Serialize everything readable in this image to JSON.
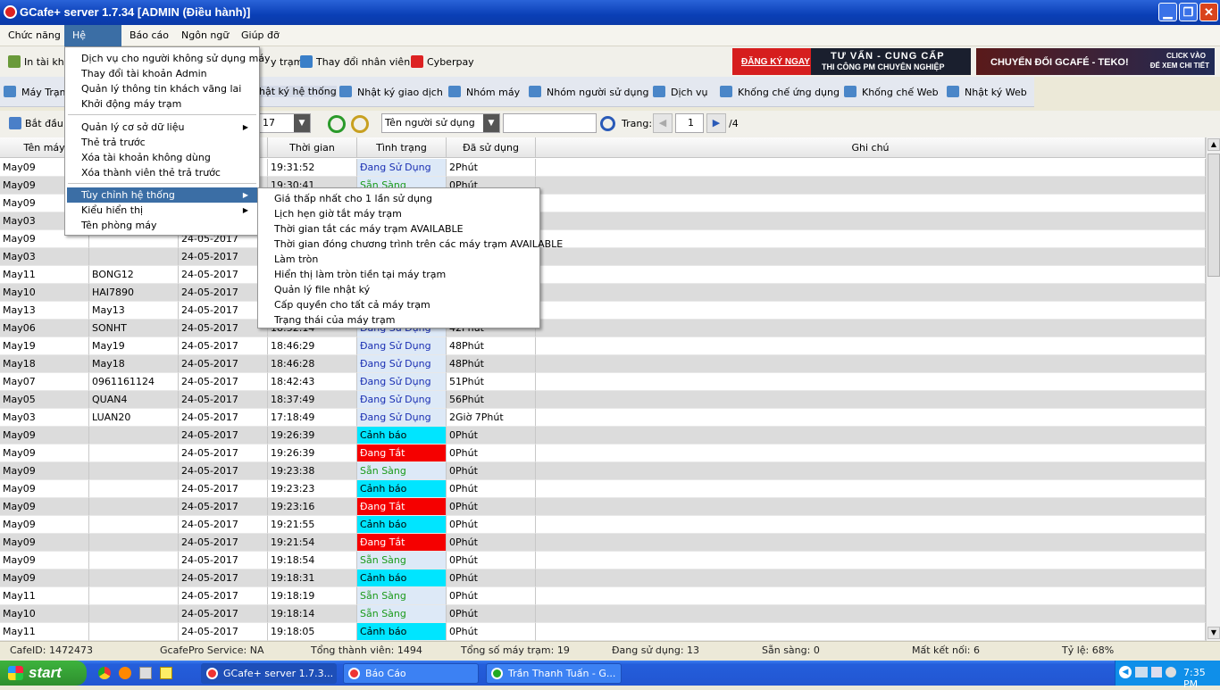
{
  "window": {
    "title": "GCafe+ server 1.7.34 [ADMIN (Điều hành)]"
  },
  "menubar": [
    "Chức năng",
    "Hệ thống",
    "Báo cáo",
    "Ngôn ngữ",
    "Giúp đỡ"
  ],
  "toolbar1": {
    "print": "In tài kho",
    "station": "y trạm",
    "change_staff": "Thay đổi nhân viên",
    "cyberpay": "Cyberpay",
    "banner1": {
      "cta": "ĐĂNG KÝ NGAY",
      "line1": "TƯ VẤN - CUNG CẤP",
      "line2": "THI CÔNG PM CHUYÊN NGHIỆP"
    },
    "banner2": {
      "main": "CHUYỂN ĐỔI  GCAFÉ - TEKO!",
      "cta1": "CLICK VÀO",
      "cta2": "ĐỂ XEM CHI TIẾT"
    }
  },
  "toolbar2": [
    "Máy Trạm",
    "hật ký hệ thống",
    "Nhật ký giao dịch",
    "Nhóm máy",
    "Nhóm người sử dụng",
    "Dịch vụ",
    "Khống chế ứng dụng",
    "Khống chế Web",
    "Nhật ký Web"
  ],
  "toolbar3": {
    "start": "Bắt đầu",
    "date_suffix": "17",
    "user_filter": "Tên người sử dụng",
    "search_value": "",
    "page_label": "Trang:",
    "page": "1",
    "page_total": "/4"
  },
  "table": {
    "headers": [
      "Tên máy",
      "",
      "",
      "Thời gian",
      "Tình trạng",
      "Đã sử dụng",
      "Ghi chú"
    ],
    "rows": [
      [
        "May09",
        "",
        "",
        "19:31:52",
        "Đang Sử Dụng",
        "2Phút"
      ],
      [
        "May09",
        "",
        "",
        "19:30:41",
        "Sẵn Sàng",
        "0Phút"
      ],
      [
        "May09",
        "",
        "",
        "",
        "",
        ""
      ],
      [
        "May03",
        "",
        "",
        "",
        "",
        ""
      ],
      [
        "May09",
        "",
        "24-05-2017",
        "",
        "",
        ""
      ],
      [
        "May03",
        "",
        "24-05-2017",
        "",
        "",
        ""
      ],
      [
        "May11",
        "BONG12",
        "24-05-2017",
        "",
        "",
        ""
      ],
      [
        "May10",
        "HAI7890",
        "24-05-2017",
        "",
        "",
        ""
      ],
      [
        "May13",
        "May13",
        "24-05-2017",
        "",
        "",
        ""
      ],
      [
        "May06",
        "SONHT",
        "24-05-2017",
        "18:52:14",
        "Đang Sử Dụng",
        "42Phút"
      ],
      [
        "May19",
        "May19",
        "24-05-2017",
        "18:46:29",
        "Đang Sử Dụng",
        "48Phút"
      ],
      [
        "May18",
        "May18",
        "24-05-2017",
        "18:46:28",
        "Đang Sử Dụng",
        "48Phút"
      ],
      [
        "May07",
        "0961161124",
        "24-05-2017",
        "18:42:43",
        "Đang Sử Dụng",
        "51Phút"
      ],
      [
        "May05",
        "QUAN4",
        "24-05-2017",
        "18:37:49",
        "Đang Sử Dụng",
        "56Phút"
      ],
      [
        "May03",
        "LUAN20",
        "24-05-2017",
        "17:18:49",
        "Đang Sử Dụng",
        "2Giờ 7Phút"
      ],
      [
        "May09",
        "",
        "24-05-2017",
        "19:26:39",
        "Cảnh báo",
        "0Phút"
      ],
      [
        "May09",
        "",
        "24-05-2017",
        "19:26:39",
        "Đang Tắt",
        "0Phút"
      ],
      [
        "May09",
        "",
        "24-05-2017",
        "19:23:38",
        "Sẵn Sàng",
        "0Phút"
      ],
      [
        "May09",
        "",
        "24-05-2017",
        "19:23:23",
        "Cảnh báo",
        "0Phút"
      ],
      [
        "May09",
        "",
        "24-05-2017",
        "19:23:16",
        "Đang Tắt",
        "0Phút"
      ],
      [
        "May09",
        "",
        "24-05-2017",
        "19:21:55",
        "Cảnh báo",
        "0Phút"
      ],
      [
        "May09",
        "",
        "24-05-2017",
        "19:21:54",
        "Đang Tắt",
        "0Phút"
      ],
      [
        "May09",
        "",
        "24-05-2017",
        "19:18:54",
        "Sẵn Sàng",
        "0Phút"
      ],
      [
        "May09",
        "",
        "24-05-2017",
        "19:18:31",
        "Cảnh báo",
        "0Phút"
      ],
      [
        "May11",
        "",
        "24-05-2017",
        "19:18:19",
        "Sẵn Sàng",
        "0Phút"
      ],
      [
        "May10",
        "",
        "24-05-2017",
        "19:18:14",
        "Sẵn Sàng",
        "0Phút"
      ],
      [
        "May11",
        "",
        "24-05-2017",
        "19:18:05",
        "Cảnh báo",
        "0Phút"
      ]
    ]
  },
  "system_menu": [
    "Dịch vụ cho người không sử dụng máy",
    "Thay đổi tài khoản Admin",
    "Quản lý thông tin khách vãng lai",
    "Khởi động máy trạm",
    "Quản lý cơ sở dữ liệu",
    "Thẻ trả trước",
    "Xóa tài khoản không dùng",
    "Xóa thành viên thẻ trả trước",
    "Tùy chỉnh hệ thống",
    "Kiểu hiển thị",
    "Tên phòng máy"
  ],
  "submenu": [
    "Giá thấp nhất cho 1 lần sử dụng",
    "Lịch hẹn giờ tắt máy trạm",
    "Thời gian tắt các máy trạm AVAILABLE",
    "Thời gian đóng chương trình trên các máy trạm AVAILABLE",
    "Làm tròn",
    "Hiển thị làm tròn tiền tại máy trạm",
    "Quản lý file nhật ký",
    "Cấp quyền cho tất cả máy trạm",
    "Trạng thái của máy trạm"
  ],
  "status": [
    "CafeID: 1472473",
    "GcafePro Service: NA",
    "Tổng thành viên: 1494",
    "Tổng số máy trạm: 19",
    "Đang sử dụng: 13",
    "Sẵn sàng: 0",
    "Mất kết nối: 6",
    "Tỷ lệ: 68%"
  ],
  "taskbar": {
    "start": "start",
    "items": [
      "GCafe+ server 1.7.3...",
      "Báo Cáo",
      "Trần Thanh Tuấn - G..."
    ],
    "clock": "7:35 PM"
  },
  "colors": {
    "title": "#0a3fb6",
    "selected": "#3b6ea5",
    "warn": "#00e5ff",
    "off": "#f50000",
    "ready_text": "#1a9a1a",
    "busy_text": "#1a2fb3"
  }
}
